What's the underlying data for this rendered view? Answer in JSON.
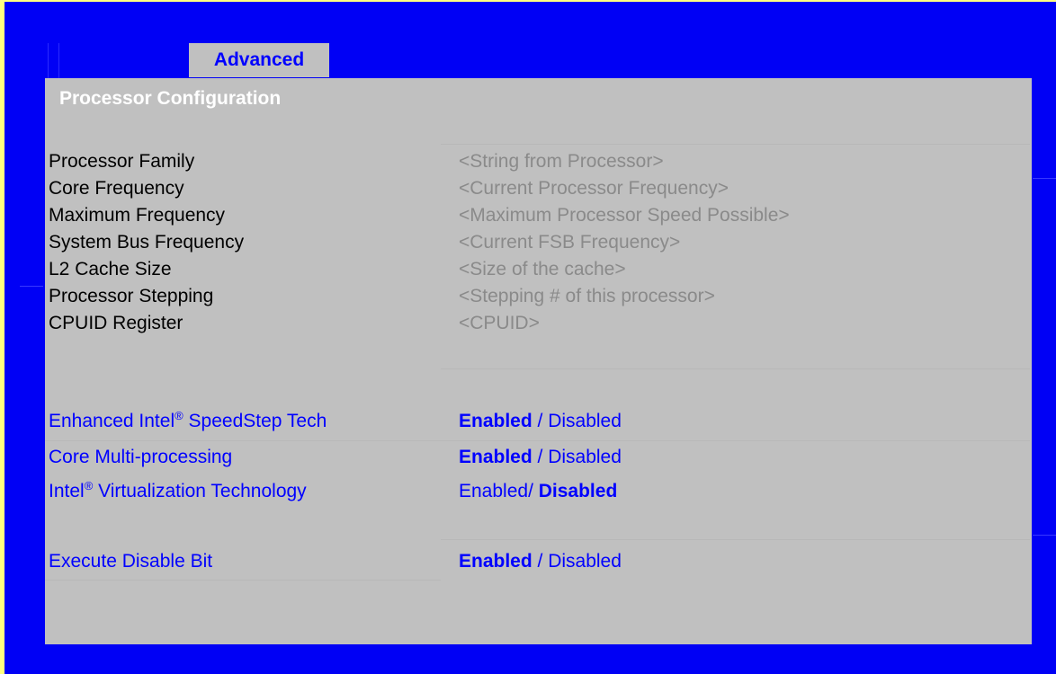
{
  "tab": {
    "label": "Advanced"
  },
  "panel": {
    "title": "Processor Configuration"
  },
  "info_rows": [
    {
      "label": "Processor Family",
      "value": "<String from Processor>"
    },
    {
      "label": "Core Frequency",
      "value": "<Current Processor Frequency>"
    },
    {
      "label": "Maximum Frequency",
      "value": "<Maximum Processor Speed Possible>"
    },
    {
      "label": "System Bus Frequency",
      "value": "<Current FSB Frequency>"
    },
    {
      "label": "L2 Cache Size",
      "value": "<Size of the cache>"
    },
    {
      "label": "Processor Stepping",
      "value": "<Stepping # of this processor>"
    },
    {
      "label": "CPUID Register",
      "value": "<CPUID>"
    }
  ],
  "options": {
    "speedstep": {
      "label_pre": "Enhanced  Intel",
      "label_sup": "®",
      "label_post": " SpeedStep Tech",
      "enabled": "Enabled",
      "sep": " / ",
      "disabled": "Disabled",
      "selected": "Enabled"
    },
    "multiproc": {
      "label": "Core Multi-processing",
      "enabled": "Enabled",
      "sep": " / ",
      "disabled": "Disabled",
      "selected": "Enabled"
    },
    "virtualization": {
      "label_pre": "Intel",
      "label_sup": "®",
      "label_post": " Virtualization Technology",
      "enabled": "Enabled/",
      "sep": " ",
      "disabled": "Disabled",
      "selected": "Disabled"
    },
    "xd_bit": {
      "label": "Execute Disable Bit",
      "enabled": "Enabled",
      "sep": " / ",
      "disabled": "Disabled",
      "selected": "Enabled"
    }
  },
  "colors": {
    "frame": "#0000f5",
    "panel": "#c0c0c0",
    "option_text": "#0000ff",
    "info_value": "#8a8a8a",
    "outer_border": "#ffff80"
  }
}
